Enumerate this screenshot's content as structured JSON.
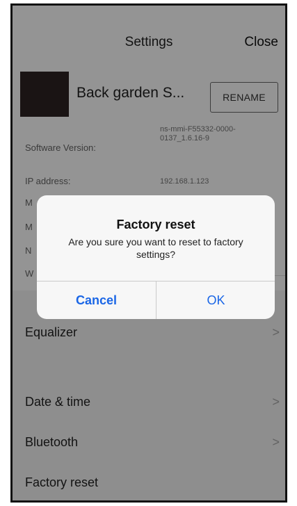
{
  "header": {
    "title": "Settings",
    "close_label": "Close"
  },
  "device": {
    "name": "Back garden S...",
    "rename_label": "RENAME"
  },
  "info": {
    "software_version_label": "Software Version:",
    "software_version_value": "ns-mmi-F55332-0000-0137_1.6.16-9",
    "ip_address_label": "IP address:",
    "ip_address_value": "192.168.1.123",
    "partial_labels": [
      "M",
      "M",
      "N",
      "W"
    ]
  },
  "menu": {
    "items": [
      {
        "label": "Equalizer"
      },
      {
        "label": "Date & time"
      },
      {
        "label": "Bluetooth"
      },
      {
        "label": "Factory reset"
      }
    ],
    "chevron": ">"
  },
  "dialog": {
    "title": "Factory reset",
    "message": "Are you sure you want to reset to factory settings?",
    "cancel_label": "Cancel",
    "ok_label": "OK",
    "button_color": "#1a66e6"
  }
}
